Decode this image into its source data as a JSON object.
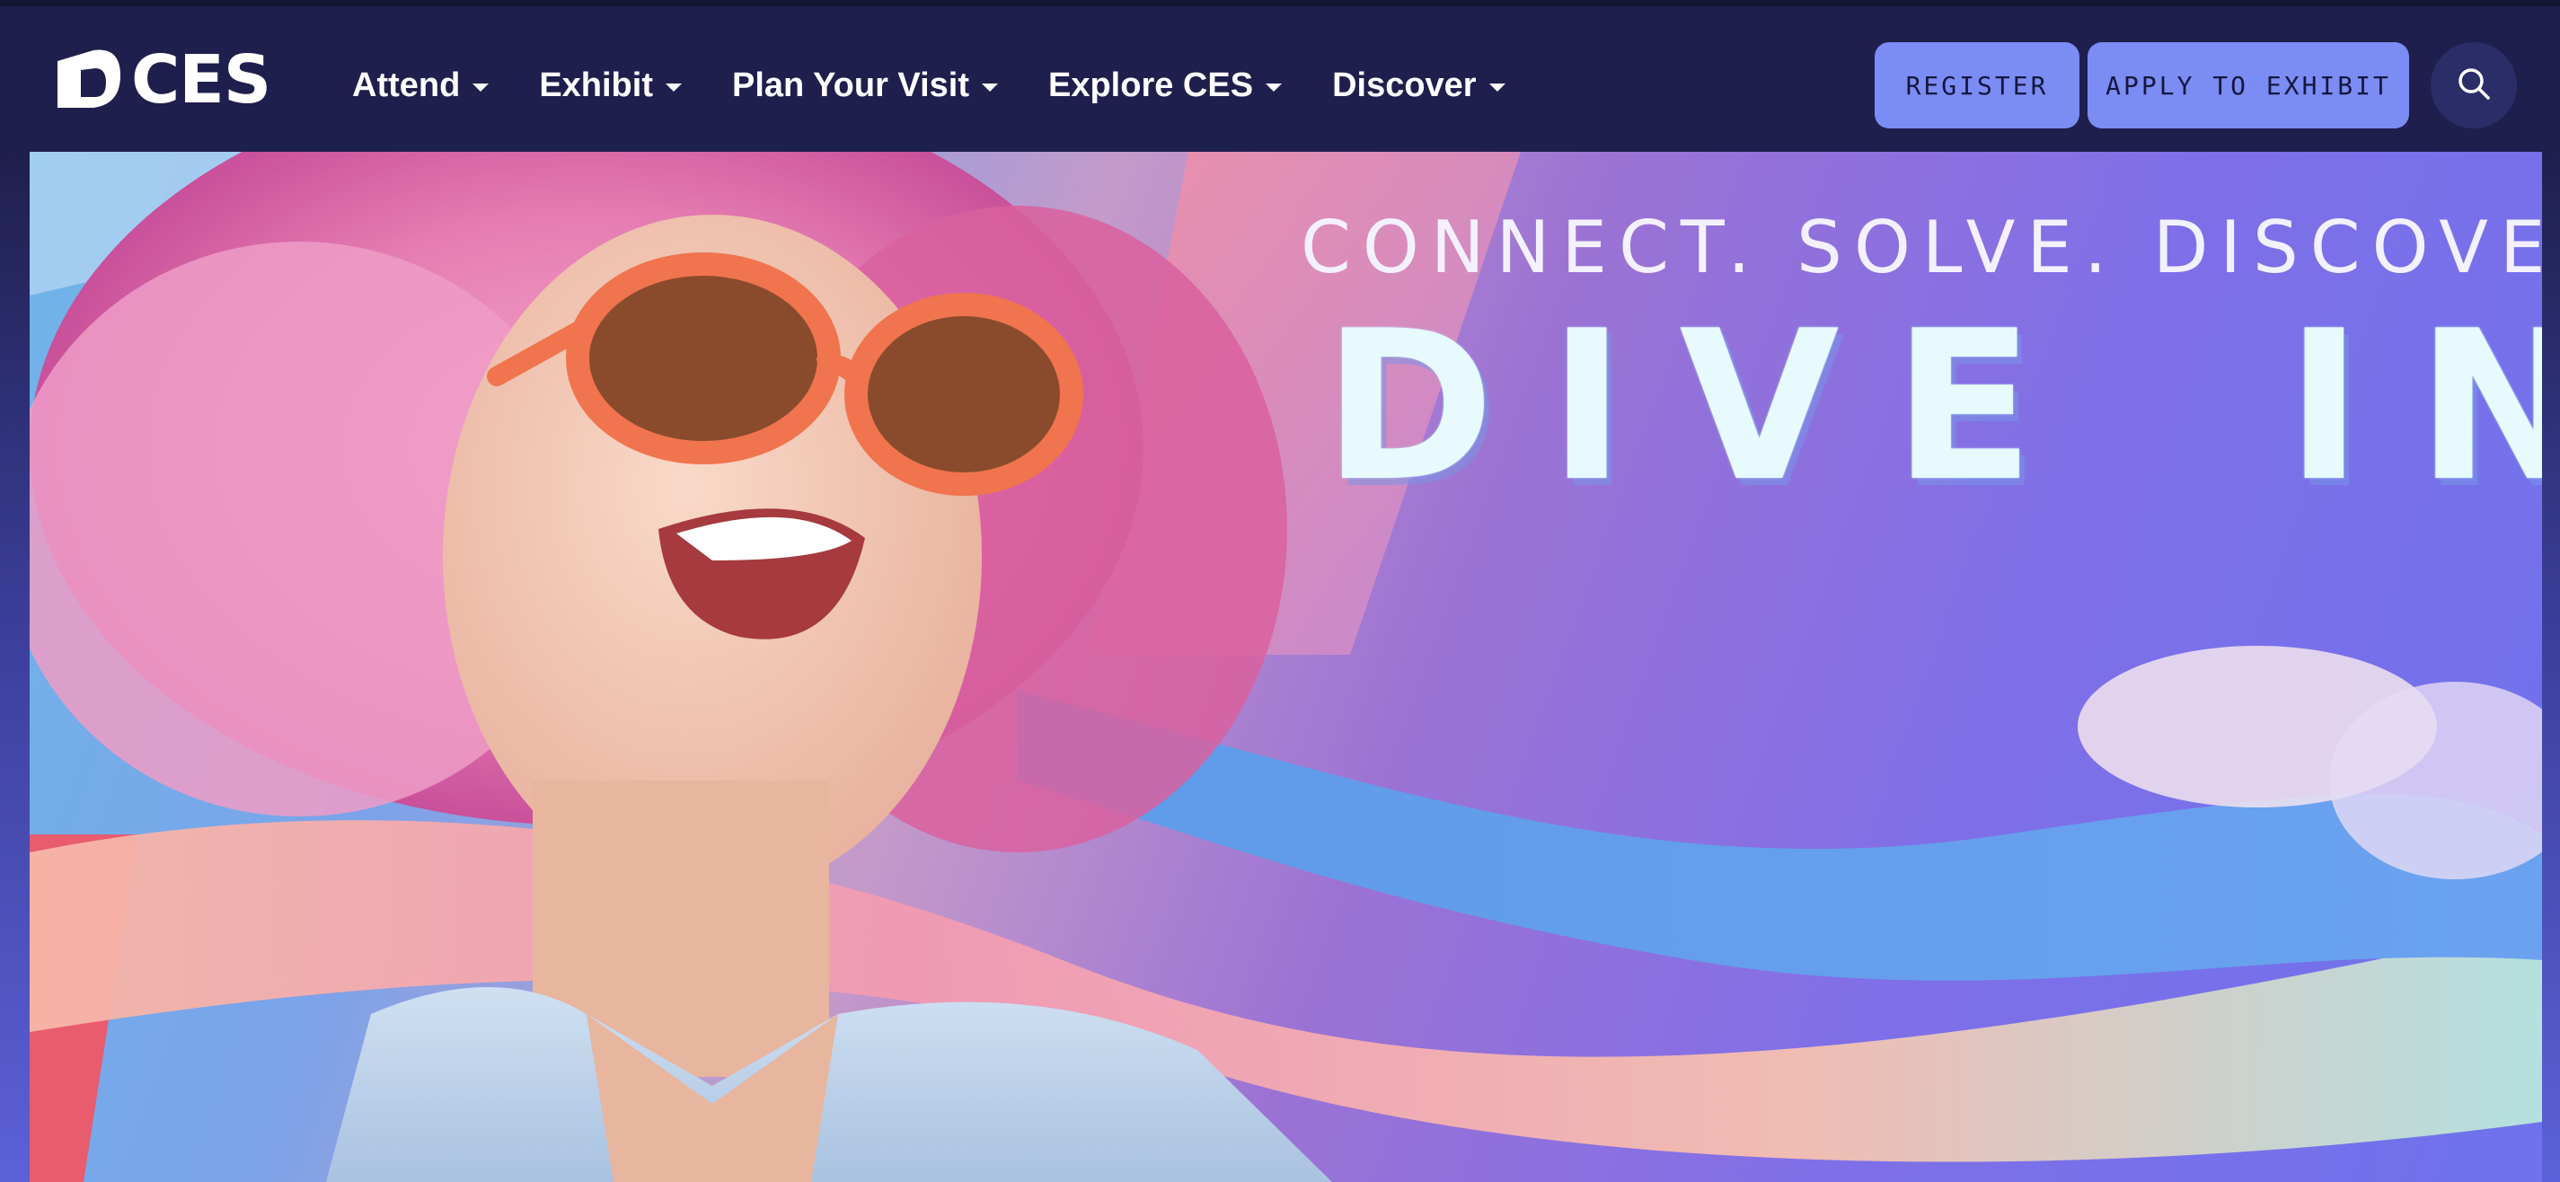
{
  "brand": {
    "logo_text": "CES",
    "logo_icon": "ces-logo-icon"
  },
  "nav": {
    "items": [
      {
        "label": "Attend"
      },
      {
        "label": "Exhibit"
      },
      {
        "label": "Plan Your Visit"
      },
      {
        "label": "Explore CES"
      },
      {
        "label": "Discover"
      }
    ]
  },
  "actions": {
    "register_label": "REGISTER",
    "apply_label": "APPLY TO EXHIBIT",
    "search_icon": "search-icon"
  },
  "hero": {
    "tagline": "CONNECT. SOLVE. DISCOVER.",
    "headline_word1": "DIVE",
    "headline_word2": "IN"
  },
  "colors": {
    "header_bg": "#1f1f4d",
    "button_bg": "#7b8cf5",
    "button_text": "#15173d",
    "hero_purple": "#8a72e0"
  }
}
